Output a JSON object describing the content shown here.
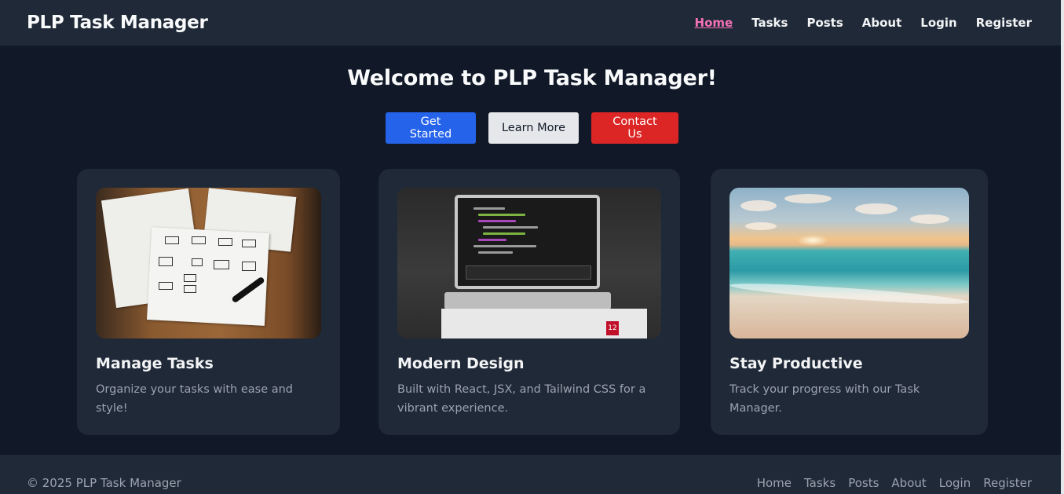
{
  "navbar": {
    "brand": "PLP Task Manager",
    "links": [
      {
        "label": "Home"
      },
      {
        "label": "Tasks"
      },
      {
        "label": "Posts"
      },
      {
        "label": "About"
      },
      {
        "label": "Login"
      },
      {
        "label": "Register"
      }
    ]
  },
  "hero": {
    "title": "Welcome to PLP Task Manager!",
    "buttons": {
      "get_started": "Get Started",
      "learn_more": "Learn More",
      "contact_us": "Contact Us"
    }
  },
  "cards": [
    {
      "title": "Manage Tasks",
      "text": "Organize your tasks with ease and style!",
      "image": "paper-workflow-sketch"
    },
    {
      "title": "Modern Design",
      "text": "Built with React, JSX, and Tailwind CSS for a vibrant experience.",
      "image": "laptop-code"
    },
    {
      "title": "Stay Productive",
      "text": "Track your progress with our Task Manager.",
      "image": "beach-sunset"
    }
  ],
  "footer": {
    "copyright": "© 2025 PLP Task Manager",
    "links": [
      {
        "label": "Home"
      },
      {
        "label": "Tasks"
      },
      {
        "label": "Posts"
      },
      {
        "label": "About"
      },
      {
        "label": "Login"
      },
      {
        "label": "Register"
      }
    ]
  },
  "colors": {
    "background": "#111827",
    "surface": "#1f2937",
    "active_link": "#f472b6",
    "primary": "#2563eb",
    "danger": "#dc2626",
    "secondary": "#e5e7eb"
  }
}
